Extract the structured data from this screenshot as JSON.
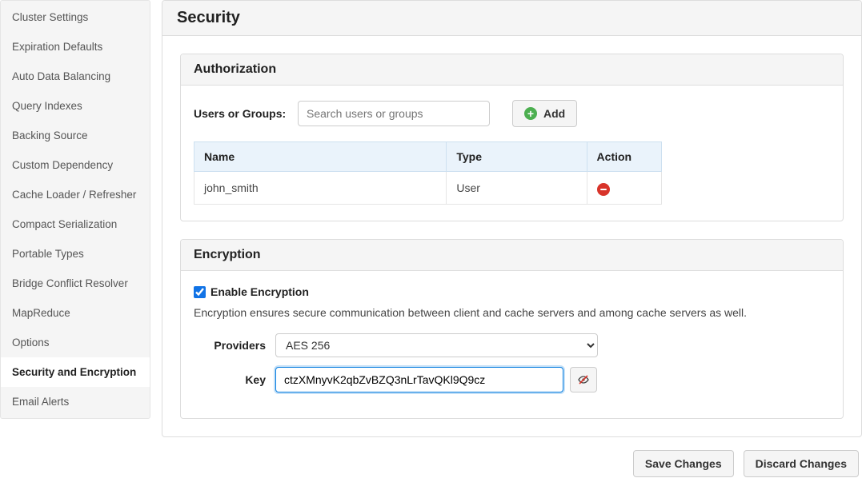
{
  "sidebar": {
    "items": [
      "Cluster Settings",
      "Expiration Defaults",
      "Auto Data Balancing",
      "Query Indexes",
      "Backing Source",
      "Custom Dependency",
      "Cache Loader / Refresher",
      "Compact Serialization",
      "Portable Types",
      "Bridge Conflict Resolver",
      "MapReduce",
      "Options",
      "Security and Encryption",
      "Email Alerts"
    ],
    "active_index": 12
  },
  "page": {
    "title": "Security"
  },
  "authorization": {
    "title": "Authorization",
    "users_label": "Users or Groups:",
    "search_placeholder": "Search users or groups",
    "add_label": "Add",
    "columns": {
      "name": "Name",
      "type": "Type",
      "action": "Action"
    },
    "rows": [
      {
        "name": "john_smith",
        "type": "User"
      }
    ]
  },
  "encryption": {
    "title": "Encryption",
    "enable_label": "Enable Encryption",
    "enabled": true,
    "description": "Encryption ensures secure communication between client and cache servers and among cache servers as well.",
    "providers_label": "Providers",
    "provider_value": "AES 256",
    "key_label": "Key",
    "key_value": "ctzXMnyvK2qbZvBZQ3nLrTavQKl9Q9cz"
  },
  "footer": {
    "save": "Save Changes",
    "discard": "Discard Changes"
  }
}
